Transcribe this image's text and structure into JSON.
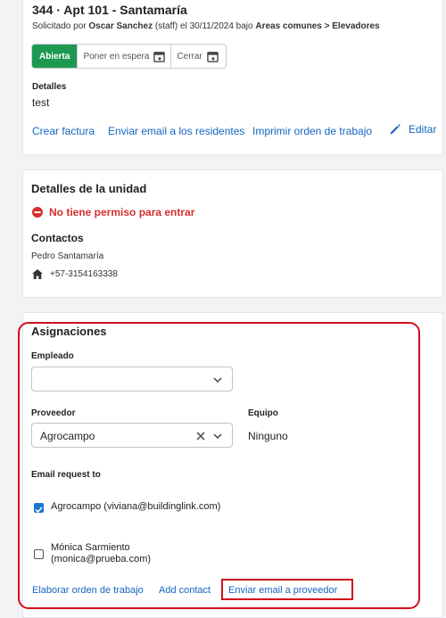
{
  "request": {
    "title": "344 · Apt 101 - Santamaría",
    "meta_prefix": "Solicitado por",
    "requester": "Oscar Sanchez",
    "meta_mid": "(staff) el 30/11/2024 bajo",
    "category": "Areas comunes > Elevadores",
    "status": {
      "open": "Abierta",
      "hold": "Poner en espera",
      "close": "Cerrar"
    },
    "details_label": "Detalles",
    "details_value": "test",
    "actions": {
      "invoice": "Crear factura",
      "email_residents": "Enviar email a los residentes",
      "print": "Imprimir orden de trabajo",
      "edit": "Editar"
    }
  },
  "unit": {
    "title": "Detalles de la unidad",
    "permission": "No tiene permiso para entrar",
    "contacts_title": "Contactos",
    "contact_name": "Pedro Santamaría",
    "contact_phone": "+57-3154163338"
  },
  "assignments": {
    "title": "Asignaciones",
    "employee_label": "Empleado",
    "employee_value": "",
    "provider_label": "Proveedor",
    "provider_value": "Agrocampo",
    "team_label": "Equipo",
    "team_value": "Ninguno",
    "email_request_label": "Email request to",
    "recipients": [
      {
        "line1": "Agrocampo (viviana@buildinglink.com)",
        "line2": "",
        "checked": true
      },
      {
        "line1": "Mónica Sarmiento",
        "line2": "(monica@prueba.com)",
        "checked": false
      }
    ],
    "actions": {
      "work_order": "Elaborar orden de trabajo",
      "add_contact": "Add contact",
      "email_provider": "Enviar email a proveedor"
    }
  },
  "colors": {
    "accent_link": "#1565c0",
    "status_open": "#1e9a50",
    "alert_red": "#d32f2f",
    "highlight_outline": "#d0101a",
    "checkbox_checked": "#1976d2"
  },
  "icons": [
    "calendar-icon",
    "pencil-icon",
    "minus-circle-icon",
    "home-icon",
    "chevron-down-icon",
    "clear-x-icon",
    "check-icon"
  ]
}
